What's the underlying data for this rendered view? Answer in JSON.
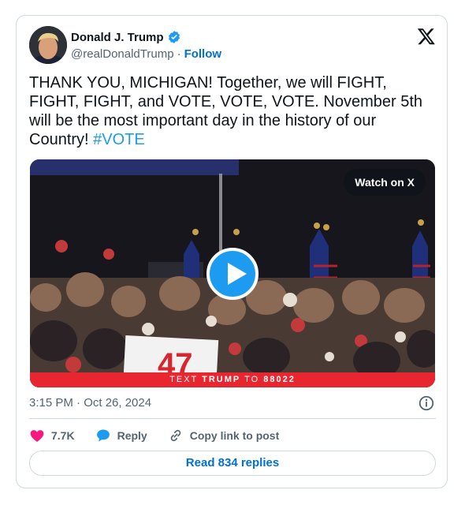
{
  "author": {
    "name": "Donald J. Trump",
    "handle": "@realDonaldTrump",
    "separator": "·",
    "follow_label": "Follow",
    "verified_icon": "verified-badge-icon"
  },
  "tweet": {
    "text": "THANK YOU, MICHIGAN! Together, we will FIGHT, FIGHT, FIGHT, and VOTE, VOTE, VOTE. November 5th will be the most important day in the history of our Country! ",
    "hashtag": "#VOTE",
    "timestamp": "3:15 PM · Oct 26, 2024"
  },
  "media": {
    "watch_label": "Watch on X",
    "banner_prefix": "TEXT ",
    "banner_keyword": "TRUMP",
    "banner_middle": " TO ",
    "banner_number": "88022",
    "sign_text": "47"
  },
  "actions": {
    "likes": "7.7K",
    "reply_label": "Reply",
    "copy_label": "Copy link to post"
  },
  "read_replies_label": "Read 834 replies",
  "colors": {
    "accent": "#1d9bf0",
    "link": "#006fd6",
    "like": "#f91880",
    "banner": "#e8262f"
  }
}
